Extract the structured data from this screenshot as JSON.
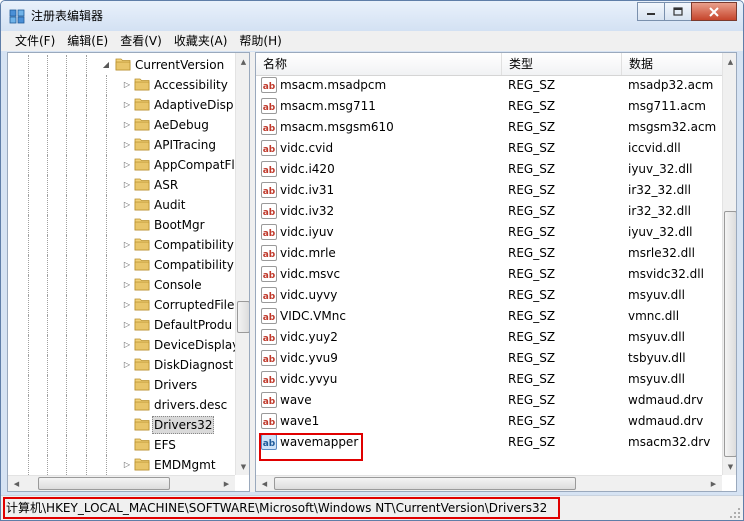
{
  "window": {
    "title": "注册表编辑器"
  },
  "menu": [
    "文件(F)",
    "编辑(E)",
    "查看(V)",
    "收藏夹(A)",
    "帮助(H)"
  ],
  "tree": {
    "parent": "CurrentVersion",
    "children": [
      {
        "label": "Accessibility",
        "expandable": true
      },
      {
        "label": "AdaptiveDisp",
        "expandable": true
      },
      {
        "label": "AeDebug",
        "expandable": true
      },
      {
        "label": "APITracing",
        "expandable": true
      },
      {
        "label": "AppCompatFl",
        "expandable": true
      },
      {
        "label": "ASR",
        "expandable": true
      },
      {
        "label": "Audit",
        "expandable": true
      },
      {
        "label": "BootMgr",
        "expandable": false
      },
      {
        "label": "Compatibility",
        "expandable": true
      },
      {
        "label": "Compatibility",
        "expandable": true
      },
      {
        "label": "Console",
        "expandable": true
      },
      {
        "label": "CorruptedFile",
        "expandable": true
      },
      {
        "label": "DefaultProdu",
        "expandable": true
      },
      {
        "label": "DeviceDisplay",
        "expandable": true
      },
      {
        "label": "DiskDiagnost",
        "expandable": true
      },
      {
        "label": "Drivers",
        "expandable": false
      },
      {
        "label": "drivers.desc",
        "expandable": false
      },
      {
        "label": "Drivers32",
        "expandable": false,
        "selected": true
      },
      {
        "label": "EFS",
        "expandable": false
      },
      {
        "label": "EMDMgmt",
        "expandable": true
      }
    ]
  },
  "list": {
    "columns": [
      "名称",
      "类型",
      "数据"
    ],
    "rows": [
      {
        "name": "msacm.msadpcm",
        "type": "REG_SZ",
        "data": "msadp32.acm"
      },
      {
        "name": "msacm.msg711",
        "type": "REG_SZ",
        "data": "msg711.acm"
      },
      {
        "name": "msacm.msgsm610",
        "type": "REG_SZ",
        "data": "msgsm32.acm"
      },
      {
        "name": "vidc.cvid",
        "type": "REG_SZ",
        "data": "iccvid.dll"
      },
      {
        "name": "vidc.i420",
        "type": "REG_SZ",
        "data": "iyuv_32.dll"
      },
      {
        "name": "vidc.iv31",
        "type": "REG_SZ",
        "data": "ir32_32.dll"
      },
      {
        "name": "vidc.iv32",
        "type": "REG_SZ",
        "data": "ir32_32.dll"
      },
      {
        "name": "vidc.iyuv",
        "type": "REG_SZ",
        "data": "iyuv_32.dll"
      },
      {
        "name": "vidc.mrle",
        "type": "REG_SZ",
        "data": "msrle32.dll"
      },
      {
        "name": "vidc.msvc",
        "type": "REG_SZ",
        "data": "msvidc32.dll"
      },
      {
        "name": "vidc.uyvy",
        "type": "REG_SZ",
        "data": "msyuv.dll"
      },
      {
        "name": "VIDC.VMnc",
        "type": "REG_SZ",
        "data": "vmnc.dll"
      },
      {
        "name": "vidc.yuy2",
        "type": "REG_SZ",
        "data": "msyuv.dll"
      },
      {
        "name": "vidc.yvu9",
        "type": "REG_SZ",
        "data": "tsbyuv.dll"
      },
      {
        "name": "vidc.yvyu",
        "type": "REG_SZ",
        "data": "msyuv.dll"
      },
      {
        "name": "wave",
        "type": "REG_SZ",
        "data": "wdmaud.drv"
      },
      {
        "name": "wave1",
        "type": "REG_SZ",
        "data": "wdmaud.drv"
      },
      {
        "name": "wavemapper",
        "type": "REG_SZ",
        "data": "msacm32.drv",
        "highlighted": true
      }
    ]
  },
  "status": {
    "path": "计算机\\HKEY_LOCAL_MACHINE\\SOFTWARE\\Microsoft\\Windows NT\\CurrentVersion\\Drivers32"
  },
  "icons": {
    "app": "regedit-icon",
    "folder": "folder-icon",
    "value": "string-value-icon"
  },
  "colors": {
    "highlight": "#e00000",
    "folder": "#e8c56a",
    "value_icon_red": "#c0392b"
  }
}
